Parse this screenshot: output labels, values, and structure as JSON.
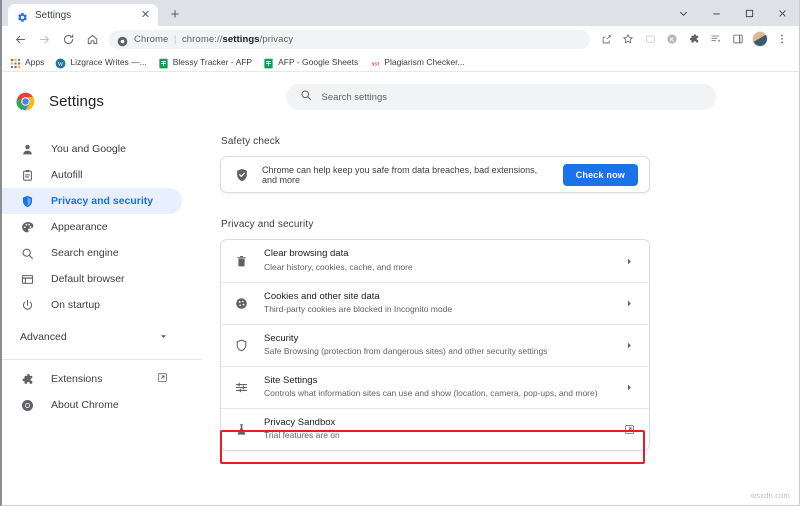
{
  "window": {
    "controls": [
      {
        "name": "chevron-down",
        "glyph": "⌄"
      },
      {
        "name": "minimize",
        "glyph": "–"
      },
      {
        "name": "maximize",
        "glyph": "□"
      },
      {
        "name": "close",
        "glyph": "✕"
      }
    ]
  },
  "tabs": [
    {
      "title": "Settings",
      "favicon": "settings-gear-icon",
      "close_glyph": "✕"
    }
  ],
  "newtab": {
    "label": "+",
    "tooltip": "New tab"
  },
  "toolbar": {
    "back": "←",
    "forward": "→",
    "reload": "⟳",
    "home": "⌂",
    "omnibox": {
      "site_icon": "chrome-icon",
      "site_label": "Chrome",
      "separator": "|",
      "url_prefix": "chrome://",
      "url_bold": "settings",
      "url_suffix": "/privacy",
      "full_url": "chrome://settings/privacy"
    },
    "right_icons": [
      {
        "name": "share-icon",
        "glyph": "↱"
      },
      {
        "name": "bookmark-star-icon",
        "glyph": "☆"
      },
      {
        "name": "media-cast-icon",
        "glyph": "▢"
      },
      {
        "name": "kami-extension-icon",
        "glyph": "K"
      },
      {
        "name": "extensions-puzzle-icon",
        "glyph": "✦"
      },
      {
        "name": "reading-list-icon",
        "glyph": "≡"
      },
      {
        "name": "side-panel-icon",
        "glyph": "◫"
      },
      {
        "name": "profile-avatar",
        "glyph": ""
      },
      {
        "name": "chrome-menu-icon",
        "glyph": "⋮"
      }
    ]
  },
  "bookmarks": [
    {
      "label": "Apps",
      "icon": "apps-grid-icon"
    },
    {
      "label": "Lizgrace Writes —...",
      "icon": "wordpress-icon"
    },
    {
      "label": "Blessy Tracker - AFP",
      "icon": "google-sheets-icon"
    },
    {
      "label": "AFP - Google Sheets",
      "icon": "google-sheets-icon"
    },
    {
      "label": "Plagiarism Checker...",
      "icon": "sst-text-icon",
      "icon_text": "SST"
    }
  ],
  "settings": {
    "brand": {
      "title": "Settings",
      "logo": "chrome-logo-icon"
    },
    "search": {
      "placeholder": "Search settings",
      "icon": "search-icon"
    },
    "nav": {
      "items": [
        {
          "label": "You and Google",
          "icon": "person-icon",
          "active": false
        },
        {
          "label": "Autofill",
          "icon": "clipboard-icon",
          "active": false
        },
        {
          "label": "Privacy and security",
          "icon": "shield-icon",
          "active": true
        },
        {
          "label": "Appearance",
          "icon": "palette-icon",
          "active": false
        },
        {
          "label": "Search engine",
          "icon": "search-icon",
          "active": false
        },
        {
          "label": "Default browser",
          "icon": "browser-window-icon",
          "active": false
        },
        {
          "label": "On startup",
          "icon": "power-icon",
          "active": false
        }
      ],
      "advanced": {
        "label": "Advanced",
        "caret": "▾",
        "icon": "chevron-down-icon"
      },
      "footer": [
        {
          "label": "Extensions",
          "icon": "puzzle-piece-icon",
          "end_icon": "external-link-icon"
        },
        {
          "label": "About Chrome",
          "icon": "chrome-logo-icon",
          "end_icon": ""
        }
      ]
    },
    "safety_check": {
      "title": "Safety check",
      "icon": "shield-check-icon",
      "message": "Chrome can help keep you safe from data breaches, bad extensions, and more",
      "button": "Check now"
    },
    "privacy_section": {
      "title": "Privacy and security",
      "rows": [
        {
          "title": "Clear browsing data",
          "subtitle": "Clear history, cookies, cache, and more",
          "icon": "trash-icon",
          "end_icon": "chevron-right-icon",
          "end_glyph": "▸",
          "highlighted": false
        },
        {
          "title": "Cookies and other site data",
          "subtitle": "Third-party cookies are blocked in Incognito mode",
          "icon": "cookie-icon",
          "end_icon": "chevron-right-icon",
          "end_glyph": "▸",
          "highlighted": false
        },
        {
          "title": "Security",
          "subtitle": "Safe Browsing (protection from dangerous sites) and other security settings",
          "icon": "shield-icon",
          "end_icon": "chevron-right-icon",
          "end_glyph": "▸",
          "highlighted": false
        },
        {
          "title": "Site Settings",
          "subtitle": "Controls what information sites can use and show (location, camera, pop-ups, and more)",
          "icon": "sliders-icon",
          "end_icon": "chevron-right-icon",
          "end_glyph": "▸",
          "highlighted": true
        },
        {
          "title": "Privacy Sandbox",
          "subtitle": "Trial features are on",
          "icon": "flask-icon",
          "end_icon": "external-link-icon",
          "end_glyph": "",
          "highlighted": false
        }
      ]
    }
  },
  "highlight": {
    "color": "#ec1c24"
  },
  "colors": {
    "accent": "#1a73e8",
    "active_pill": "#e8f0fe",
    "tabstrip": "#dee1e6",
    "field": "#f1f3f4",
    "text_primary": "#202124",
    "text_secondary": "#5f6368"
  },
  "watermark": {
    "text": "wsxdn.com"
  }
}
